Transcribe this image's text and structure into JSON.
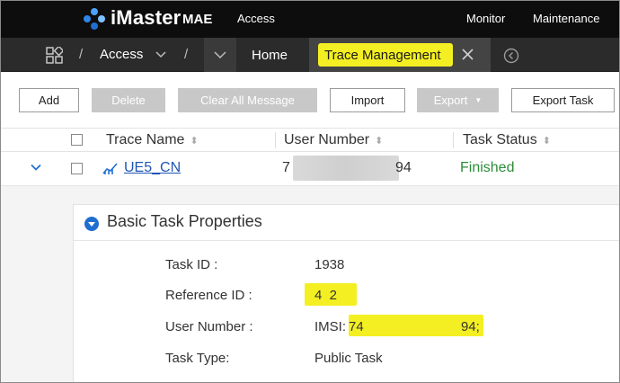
{
  "topbar": {
    "brand": "iMaster",
    "brand_sub": "MAE",
    "section": "Access",
    "monitor": "Monitor",
    "maintenance": "Maintenance"
  },
  "navbar": {
    "separator": "/",
    "access": "Access",
    "tabs": [
      {
        "label": "Home",
        "active": false
      },
      {
        "label": "Trace Management",
        "active": true
      }
    ]
  },
  "toolbar": {
    "add": "Add",
    "delete": "Delete",
    "clear_all": "Clear All Message",
    "import": "Import",
    "export": "Export",
    "export_task": "Export Task"
  },
  "table": {
    "columns": [
      "Trace Name",
      "User Number",
      "Task Status"
    ],
    "rows": [
      {
        "trace_name": "UE5_CN",
        "user_number_start": "7",
        "user_number_end": "94",
        "status": "Finished"
      }
    ]
  },
  "details": {
    "title": "Basic Task Properties",
    "fields": [
      {
        "label": "Task ID :",
        "value": "1938"
      },
      {
        "label": "Reference ID :",
        "value": "4  2"
      },
      {
        "label": "User Number :",
        "value_prefix": "IMSI:",
        "value_start": "74",
        "value_end": "94;"
      },
      {
        "label": "Task Type:",
        "value": "Public Task"
      }
    ]
  },
  "colors": {
    "highlight": "#f4ef22",
    "link": "#1f56b3",
    "finished": "#2e8b3a",
    "topbar": "#0d0d0d"
  }
}
